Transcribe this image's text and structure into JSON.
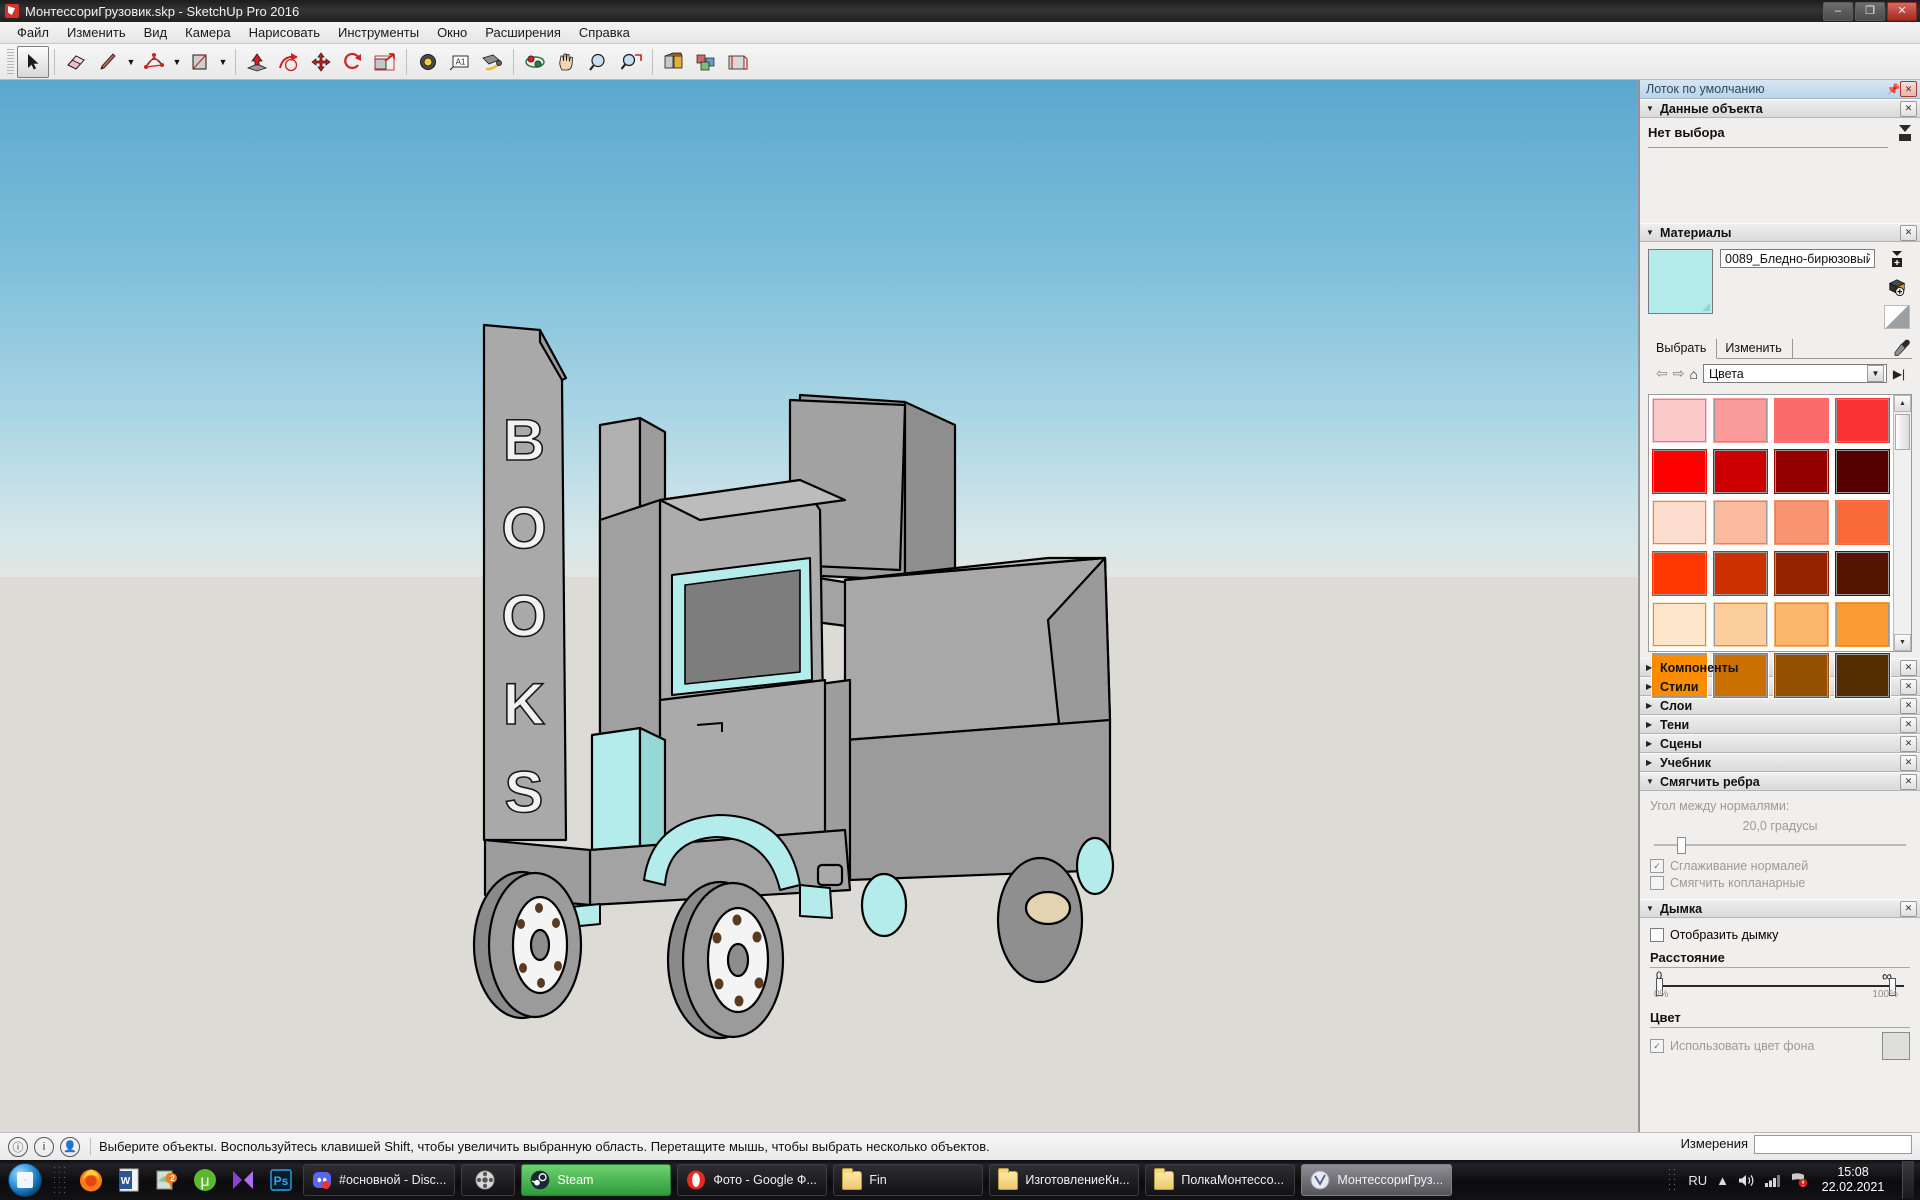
{
  "window": {
    "title": "МонтессориГрузовик.skp - SketchUp Pro 2016",
    "app_icon": "sketchup-icon",
    "minimize": "–",
    "maximize": "❐",
    "close": "✕"
  },
  "menubar": {
    "items": [
      {
        "label": "Файл"
      },
      {
        "label": "Изменить"
      },
      {
        "label": "Вид"
      },
      {
        "label": "Камера"
      },
      {
        "label": "Нарисовать"
      },
      {
        "label": "Инструменты"
      },
      {
        "label": "Окно"
      },
      {
        "label": "Расширения"
      },
      {
        "label": "Справка"
      }
    ]
  },
  "toolbar": {
    "tools": [
      {
        "name": "select-tool",
        "icon": "cursor-arrow-icon",
        "active": true
      },
      {
        "name": "eraser-tool",
        "icon": "eraser-icon"
      },
      {
        "name": "line-tool",
        "icon": "pencil-line-icon"
      },
      {
        "name": "arc-tool",
        "icon": "arc-icon"
      },
      {
        "name": "rectangle-tool",
        "icon": "rectangle-icon"
      },
      {
        "name": "pushpull-tool",
        "icon": "push-pull-icon"
      },
      {
        "name": "followme-tool",
        "icon": "follow-me-icon"
      },
      {
        "name": "move-tool",
        "icon": "move-icon"
      },
      {
        "name": "rotate-tool",
        "icon": "rotate-icon"
      },
      {
        "name": "scale-tool",
        "icon": "scale-icon"
      },
      {
        "name": "tape-measure-tool",
        "icon": "tape-measure-icon"
      },
      {
        "name": "text-tool",
        "icon": "text-a1-icon"
      },
      {
        "name": "dimension-tool",
        "icon": "dimension-icon"
      },
      {
        "name": "orbit-tool",
        "icon": "orbit-icon"
      },
      {
        "name": "pan-tool",
        "icon": "hand-pan-icon"
      },
      {
        "name": "zoom-tool",
        "icon": "magnifier-icon"
      },
      {
        "name": "zoom-extents-tool",
        "icon": "zoom-extents-icon"
      },
      {
        "name": "paint-bucket-tool",
        "icon": "paint-bucket-icon"
      },
      {
        "name": "components-tool",
        "icon": "components-icon"
      },
      {
        "name": "section-plane-tool",
        "icon": "section-plane-icon"
      }
    ]
  },
  "viewport": {
    "model_name": "BOOKS truck",
    "model_text": "BOOKS",
    "sky_color": "#5aa8ce",
    "ground_color": "#dddbd6",
    "body_color": "#a6a6a6",
    "accent_color": "#b3ecea"
  },
  "tray": {
    "title": "Лоток по умолчанию",
    "pin_icon": "pin-icon",
    "close_icon": "close-icon",
    "entity_info": {
      "title": "Данные объекта",
      "no_selection": "Нет выбора",
      "collapsed": false
    },
    "materials": {
      "title": "Материалы",
      "material_name": "0089_Бледно-бирюзовый",
      "swatch_color": "#b3ecea",
      "tabs": [
        {
          "label": "Выбрать",
          "active": true
        },
        {
          "label": "Изменить",
          "active": false
        }
      ],
      "library": "Цвета",
      "back_icon": "arrow-back-icon",
      "forward_icon": "arrow-forward-icon",
      "home_icon": "home-icon",
      "details_icon": "details-arrow-icon",
      "eyedropper_icon": "eyedropper-icon",
      "create_material_icon": "create-material-icon",
      "display_menu_icon": "display-menu-icon",
      "palette_colors": [
        "#fbc9c9",
        "#fa9a9a",
        "#fa6a6a",
        "#fa3232",
        "#fe0000",
        "#cc0000",
        "#930000",
        "#540000",
        "#fcdccd",
        "#fbb99e",
        "#fa9370",
        "#fa6a38",
        "#fe3600",
        "#cc3000",
        "#932300",
        "#541400",
        "#fde6cc",
        "#fcce9c",
        "#fbb66c",
        "#fa9c33",
        "#fc8c00",
        "#cb7000",
        "#925000",
        "#532d00"
      ]
    },
    "sections": [
      {
        "label": "Компоненты",
        "expanded": false
      },
      {
        "label": "Стили",
        "expanded": false
      },
      {
        "label": "Слои",
        "expanded": false
      },
      {
        "label": "Тени",
        "expanded": false
      },
      {
        "label": "Сцены",
        "expanded": false
      },
      {
        "label": "Учебник",
        "expanded": false
      }
    ],
    "soften_edges": {
      "title": "Смягчить ребра",
      "angle_label": "Угол между нормалями:",
      "angle_value": "20,0  градусы",
      "smooth_normals": "Сглаживание нормалей",
      "smooth_normals_checked": true,
      "soften_coplanar": "Смягчить копланарные",
      "soften_coplanar_checked": false
    },
    "fog": {
      "title": "Дымка",
      "display_fog": "Отобразить дымку",
      "display_fog_checked": false,
      "distance_title": "Расстояние",
      "distance_min": "0",
      "distance_max": "∞",
      "pct_min": "0%",
      "pct_max": "100%",
      "color_title": "Цвет",
      "use_bg_color": "Использовать цвет фона",
      "use_bg_color_checked": true,
      "color_value": "#dededc"
    }
  },
  "statusbar": {
    "info_icon": "info-circle-icon",
    "help_icon": "help-circle-icon",
    "person_icon": "person-circle-icon",
    "message": "Выберите объекты. Воспользуйтесь клавишей Shift, чтобы увеличить выбранную область. Перетащите мышь, чтобы выбрать несколько объектов.",
    "measurements_label": "Измерения",
    "measurements_value": ""
  },
  "taskbar": {
    "start_icon": "windows-start-icon",
    "quicklaunch": [
      {
        "name": "firefox-icon",
        "label": "Firefox"
      },
      {
        "name": "word-icon",
        "label": "Word"
      },
      {
        "name": "mapsme-icon",
        "label": "Maps"
      },
      {
        "name": "utorrent-icon",
        "label": "uTorrent"
      },
      {
        "name": "potplayer-icon",
        "label": "PotPlayer"
      },
      {
        "name": "photoshop-icon",
        "label": "Ps"
      }
    ],
    "buttons": [
      {
        "label": "#основной - Disc...",
        "icon": "discord-icon",
        "state": "normal"
      },
      {
        "label": "",
        "icon": "film-reel-icon",
        "state": "normal"
      },
      {
        "label": "Steam",
        "icon": "steam-icon",
        "state": "green"
      },
      {
        "label": "Фото - Google Ф...",
        "icon": "opera-icon",
        "state": "normal"
      },
      {
        "label": "Fin",
        "icon": "folder-icon",
        "state": "normal"
      },
      {
        "label": "ИзготовлениеКн...",
        "icon": "folder-icon",
        "state": "normal"
      },
      {
        "label": "ПолкаМонтессо...",
        "icon": "folder-icon",
        "state": "normal"
      },
      {
        "label": "МонтессориГруз...",
        "icon": "sketchup-icon",
        "state": "active"
      }
    ],
    "tray": {
      "language": "RU",
      "show_hidden_icon": "chevron-up-icon",
      "volume_icon": "speaker-icon",
      "network_icon": "signal-bars-icon",
      "action_center_icon": "flag-alert-icon",
      "time": "15:08",
      "date": "22.02.2021"
    }
  }
}
